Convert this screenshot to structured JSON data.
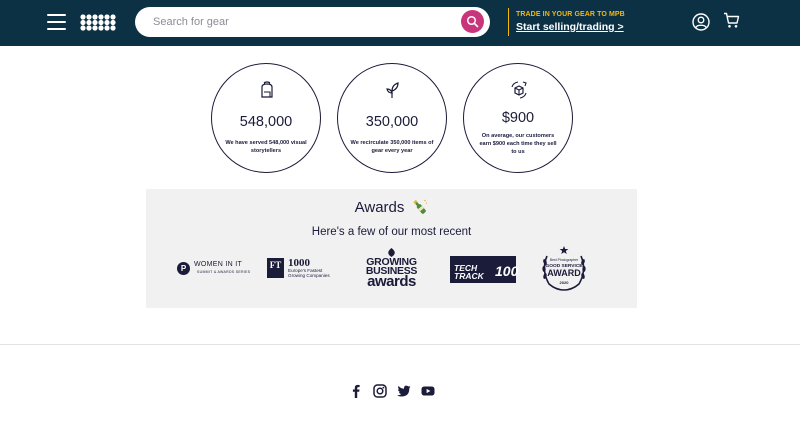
{
  "header": {
    "search_placeholder": "Search for gear",
    "trade_text": "TRADE IN YOUR GEAR TO MPB",
    "sell_link": "Start selling/trading >"
  },
  "stats": [
    {
      "value": "548,000",
      "description": "We have served 548,000 visual storytellers",
      "icon": "backpack-icon"
    },
    {
      "value": "350,000",
      "description": "We recirculate 350,000 items of gear every year",
      "icon": "sprout-icon"
    },
    {
      "value": "$900",
      "description": "On average, our customers earn $900 each time they sell to us",
      "icon": "recycle-box-icon"
    }
  ],
  "awards": {
    "title": "Awards",
    "subtitle": "Here's a few of our most recent",
    "logos": {
      "women_in_it": {
        "p": "P",
        "line1": "WOMEN IN IT",
        "line2": "SUMMIT & AWARDS SERIES"
      },
      "ft1000": {
        "mark": "FT",
        "number": "1000",
        "line1": "Europe's Fastest",
        "line2": "Growing Companies"
      },
      "growing_business": {
        "line1": "GROWING",
        "line2": "BUSINESS",
        "line3": "awards"
      },
      "tech_track": {
        "line1": "TECH",
        "line2": "TRACK",
        "number": "100"
      },
      "good_service": {
        "top": "Best Photographer",
        "line1": "GOOD SERVICE",
        "line2": "AWARD",
        "year": "2020"
      }
    }
  },
  "colors": {
    "header_bg": "#0c3144",
    "accent_pink": "#c9357a",
    "accent_yellow": "#f6b80c",
    "navy": "#1b1b3a",
    "awards_bg": "#f1f1f1"
  },
  "social": [
    "facebook-icon",
    "instagram-icon",
    "twitter-icon",
    "youtube-icon"
  ]
}
